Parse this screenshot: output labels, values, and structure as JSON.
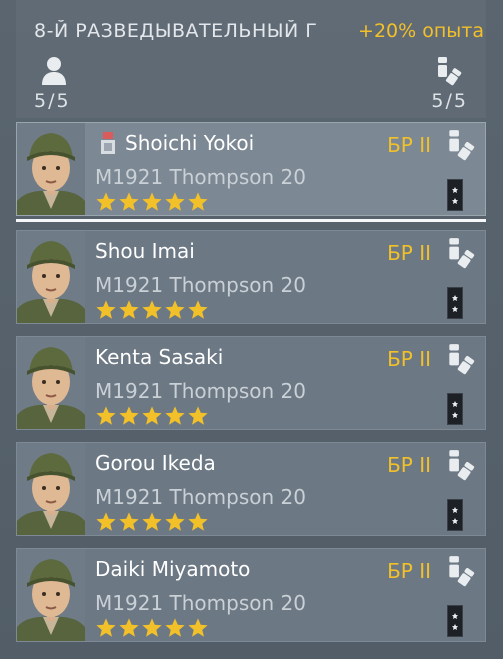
{
  "squad": {
    "name": "8-Й РАЗВЕДЫВАТЕЛЬНЫЙ Г",
    "exp_bonus": "+20% опыта",
    "soldiers_count": "5/5",
    "ammo_count": "5/5",
    "icons": {
      "soldiers": "person-icon",
      "ammo": "ammo-icon"
    }
  },
  "soldiers": [
    {
      "name": "Shoichi Yokoi",
      "weapon": "M1921 Thompson 20",
      "br": "БР II",
      "stars": 5,
      "selected": true,
      "has_badge": true
    },
    {
      "name": "Shou Imai",
      "weapon": "M1921 Thompson 20",
      "br": "БР II",
      "stars": 5,
      "selected": false,
      "has_badge": false
    },
    {
      "name": "Kenta Sasaki",
      "weapon": "M1921 Thompson 20",
      "br": "БР II",
      "stars": 5,
      "selected": false,
      "has_badge": false
    },
    {
      "name": "Gorou Ikeda",
      "weapon": "M1921 Thompson 20",
      "br": "БР II",
      "stars": 5,
      "selected": false,
      "has_badge": false
    },
    {
      "name": "Daiki Miyamoto",
      "weapon": "M1921 Thompson 20",
      "br": "БР II",
      "stars": 5,
      "selected": false,
      "has_badge": false
    }
  ],
  "colors": {
    "accent": "#f2c029",
    "text": "#ffffff",
    "row_bg": "#6c7884",
    "row_selected_bg": "#7c8893",
    "panel_bg": "#56616b"
  }
}
